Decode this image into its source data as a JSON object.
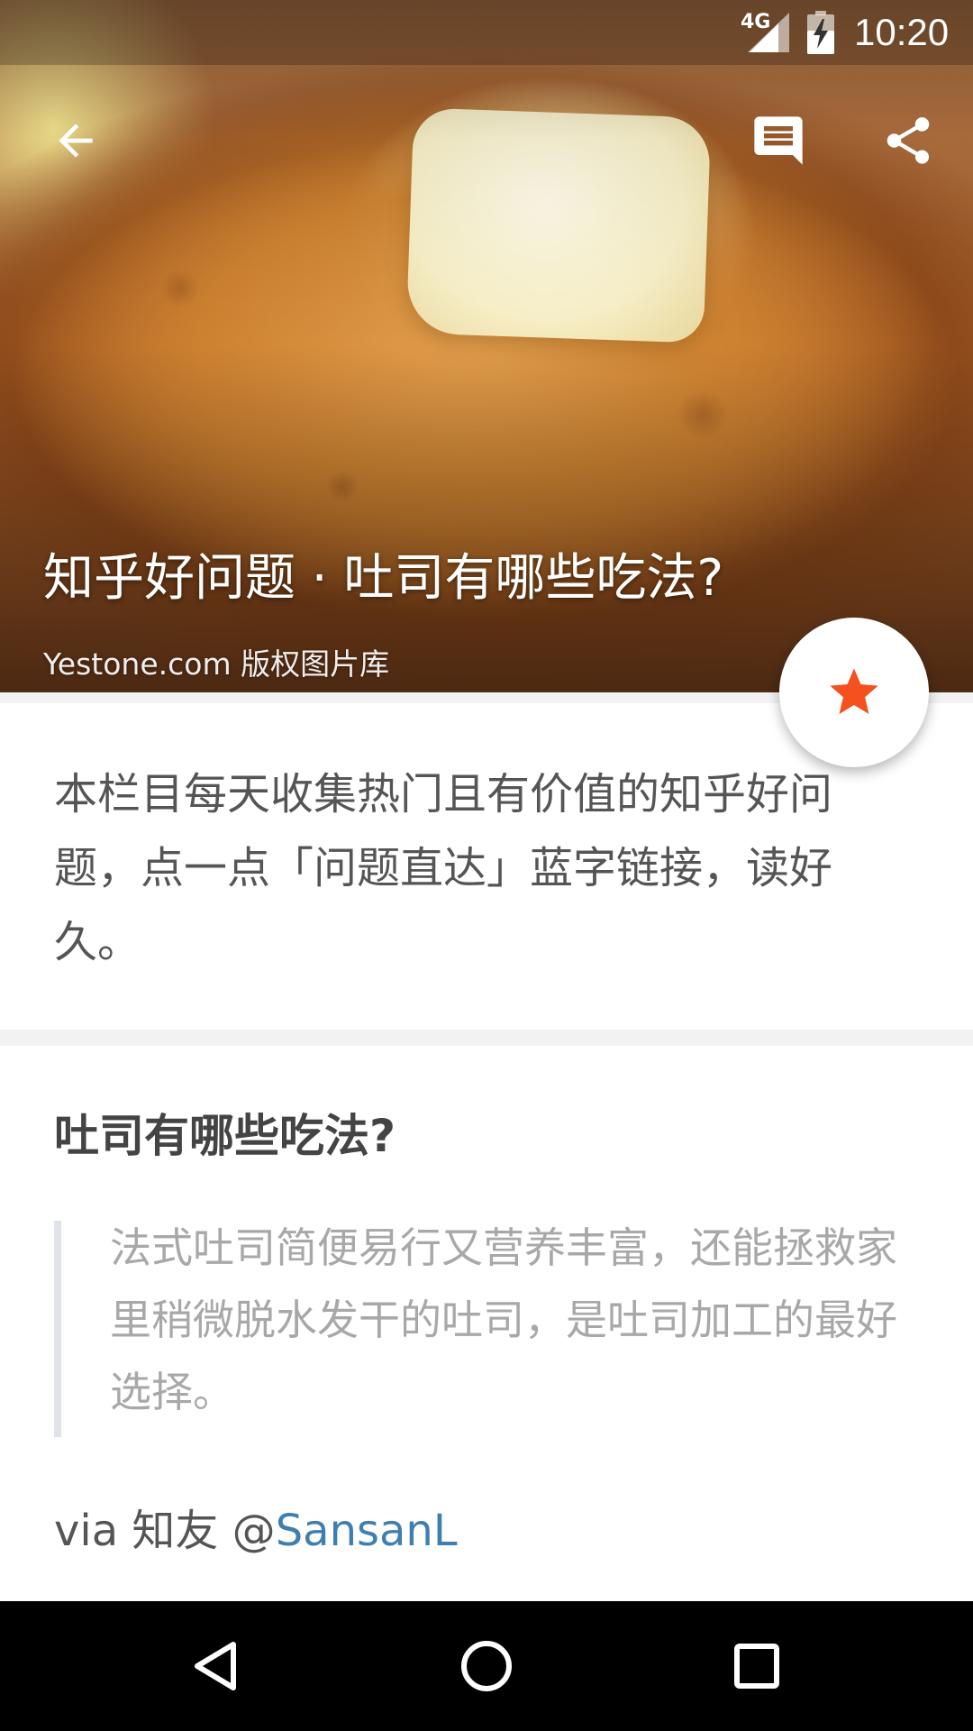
{
  "status_bar": {
    "network": "4G",
    "time": "10:20"
  },
  "hero": {
    "title": "知乎好问题 · 吐司有哪些吃法?",
    "credit": "Yestone.com 版权图片库"
  },
  "toolbar": {
    "back_icon": "arrow-back-icon",
    "comment_icon": "comment-icon",
    "share_icon": "share-icon"
  },
  "fab": {
    "icon": "star-icon",
    "color": "#f4511e"
  },
  "intro": {
    "text": "本栏目每天收集热门且有价值的知乎好问题，点一点「问题直达」蓝字链接，读好久。"
  },
  "question": {
    "title": "吐司有哪些吃法?",
    "quote": "法式吐司简便易行又营养丰富，还能拯救家里稍微脱水发干的吐司，是吐司加工的最好选择。",
    "via_prefix": "via 知友 @",
    "via_user": "SansanL",
    "link_color": "#3f7fb0"
  },
  "nav_bar": {
    "back_icon": "nav-back-icon",
    "home_icon": "nav-home-icon",
    "recent_icon": "nav-recent-icon"
  }
}
